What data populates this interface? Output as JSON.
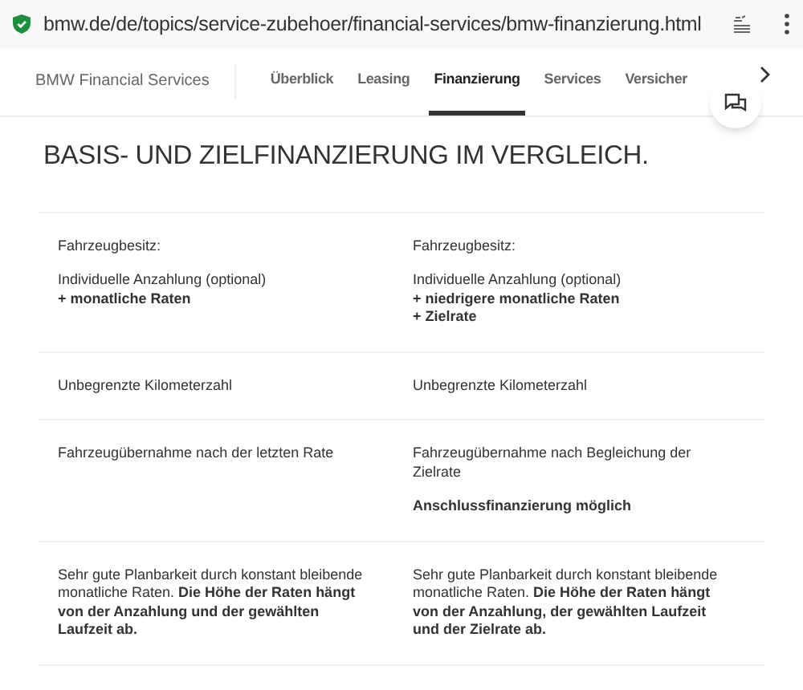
{
  "address_bar": {
    "url": "bmw.de/de/topics/service-zubehoer/financial-services/bmw-finanzierung.html"
  },
  "nav": {
    "brand": "BMW Financial Services",
    "tabs": [
      {
        "label": "Überblick",
        "selected": false
      },
      {
        "label": "Leasing",
        "selected": false
      },
      {
        "label": "Finanzierung",
        "selected": true
      },
      {
        "label": "Services",
        "selected": false
      },
      {
        "label": "Versicher",
        "selected": false
      }
    ]
  },
  "heading": "BASIS- UND ZIELFINANZIERUNG IM VERGLEICH.",
  "comparison": [
    {
      "cells": [
        [
          "Fahrzeugbesitz:",
          "Individuelle Anzahlung (optional)\n**+ monatliche Raten**"
        ],
        [
          "Fahrzeugbesitz:",
          "Individuelle Anzahlung (optional)\n**+ niedrigere monatliche Raten**\n**+ Zielrate**"
        ]
      ]
    },
    {
      "cells": [
        [
          "Unbegrenzte Kilometerzahl"
        ],
        [
          "Unbegrenzte Kilometerzahl"
        ]
      ]
    },
    {
      "cells": [
        [
          "Fahrzeugübernahme nach der letzten Rate"
        ],
        [
          "Fahrzeugübernahme nach Begleichung der Zielrate",
          "**Anschlussfinanzierung möglich**"
        ]
      ]
    },
    {
      "cells": [
        [
          "Sehr gute Planbarkeit durch konstant bleibende monatliche Raten. **Die Höhe der Raten hängt von der Anzahlung und der gewählten Laufzeit ab.**"
        ],
        [
          "Sehr gute Planbarkeit durch konstant bleibende monatliche Raten. **Die Höhe der Raten hängt von der Anzahlung, der gewählten Laufzeit und der Zielrate ab.**"
        ]
      ]
    }
  ]
}
